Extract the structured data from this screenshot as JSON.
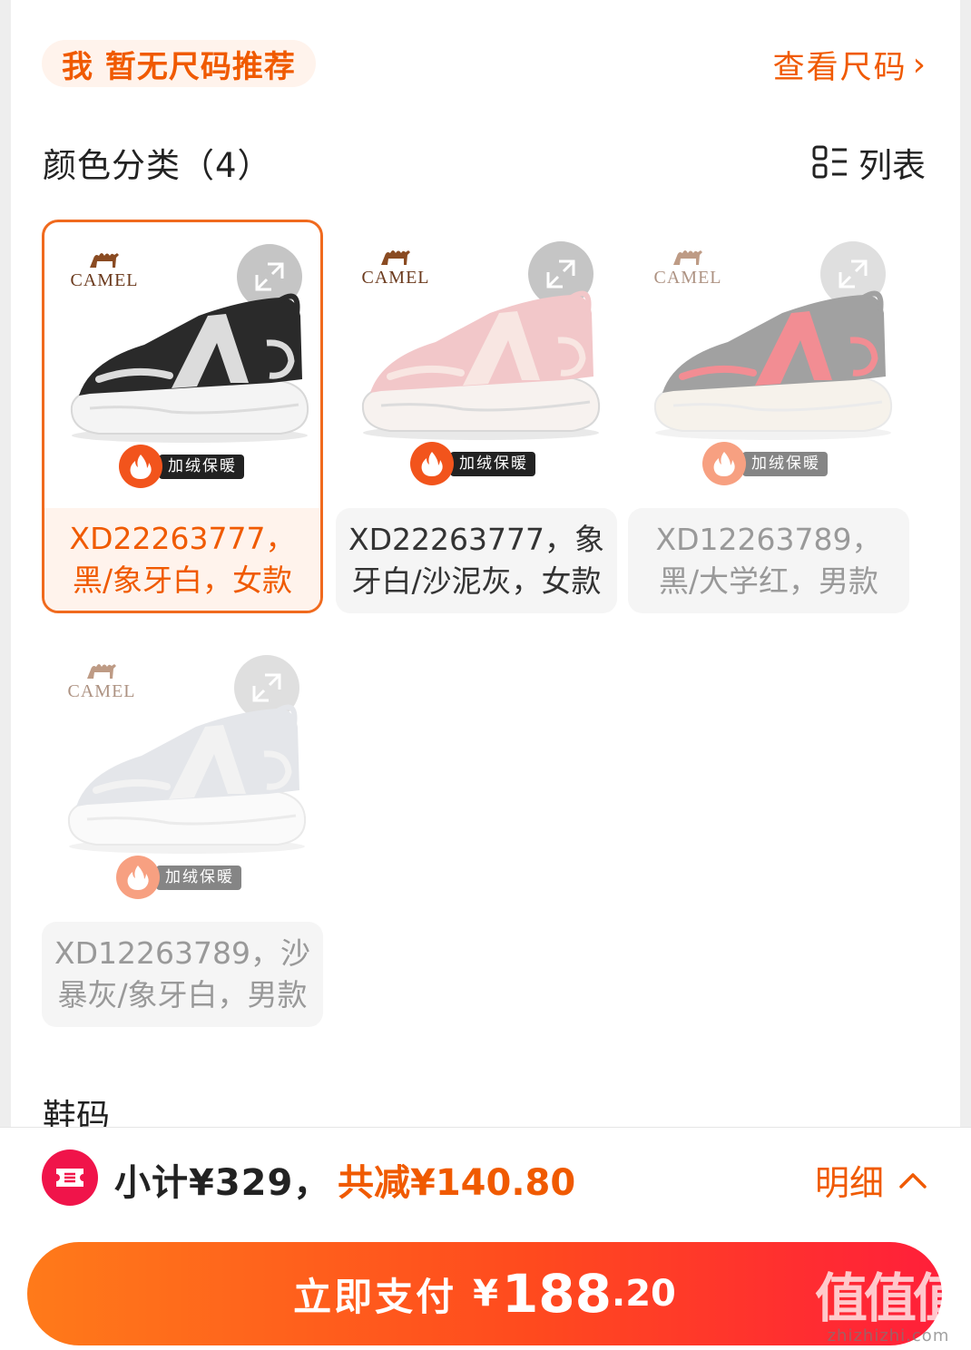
{
  "size_recommendation": {
    "pill_text": "我 暂无尺码推荐",
    "view_sizes_label": "查看尺码"
  },
  "color_section": {
    "title": "颜色分类（4）",
    "list_toggle_label": "列表"
  },
  "variants": [
    {
      "label": "XD22263777，黑/象牙白，女款",
      "badge": "加绒保暖",
      "brand": "CAMEL",
      "selected": true,
      "shoe_colors": {
        "upper": "#2a2a2a",
        "accent": "#dcdcdc",
        "sole": "#f4f4f4"
      }
    },
    {
      "label": "XD22263777，象牙白/沙泥灰，女款",
      "badge": "加绒保暖",
      "brand": "CAMEL",
      "selected": false,
      "shoe_colors": {
        "upper": "#f2c7c9",
        "accent": "#f8e6e2",
        "sole": "#f7f2ef"
      }
    },
    {
      "label": "XD12263789，黑/大学红，男款",
      "badge": "加绒保暖",
      "brand": "CAMEL",
      "selected": false,
      "shoe_colors": {
        "upper": "#555555",
        "accent": "#e8313c",
        "sole": "#efe9dc"
      }
    },
    {
      "label": "XD12263789，沙暴灰/象牙白，男款",
      "badge": "加绒保暖",
      "brand": "CAMEL",
      "selected": false,
      "shoe_colors": {
        "upper": "#cfd3d9",
        "accent": "#e8e8e8",
        "sole": "#f6f6f6"
      }
    }
  ],
  "shoe_size_section": {
    "title": "鞋码"
  },
  "footer": {
    "subtotal": "小计¥329，",
    "discount": "共减¥140.80",
    "detail_label": "明细",
    "pay_label": "立即支付",
    "currency": "¥",
    "amount_int": "188",
    "amount_dec": ".20"
  },
  "watermark": {
    "main": "值值值",
    "sub": "zhizhizhi.com"
  },
  "colors": {
    "accent": "#f05a00",
    "pay_start": "#ff7a1a",
    "pay_end": "#ff1f3a",
    "coupon": "#f0144a"
  }
}
